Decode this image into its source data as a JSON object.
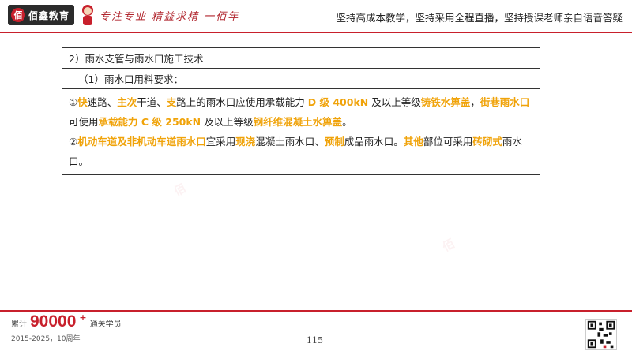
{
  "header": {
    "logo_mark": "佰",
    "logo_text": "佰鑫教育",
    "slogan": "专注专业  精益求精  一佰年",
    "tagline": "坚持高成本教学，坚持采用全程直播，坚持授课老师亲自语音答疑"
  },
  "content": {
    "title": "2）雨水支管与雨水口施工技术",
    "subtitle": "（1）雨水口用料要求：",
    "p1": [
      {
        "t": "①",
        "h": false
      },
      {
        "t": "快",
        "h": true
      },
      {
        "t": "速路、",
        "h": false
      },
      {
        "t": "主次",
        "h": true
      },
      {
        "t": "干道、",
        "h": false
      },
      {
        "t": "支",
        "h": true
      },
      {
        "t": "路上的雨水口应使用承载能力 ",
        "h": false
      },
      {
        "t": "D 级 400kN",
        "h": true
      },
      {
        "t": " 及以上等级",
        "h": false
      },
      {
        "t": "铸铁水箅盖",
        "h": true
      },
      {
        "t": "，",
        "h": false
      },
      {
        "t": "街巷雨水口",
        "h": true
      },
      {
        "t": "可使用",
        "h": false
      },
      {
        "t": "承载能力 C 级 250kN",
        "h": true
      },
      {
        "t": " 及以上等级",
        "h": false
      },
      {
        "t": "钢纤维混凝土水箅盖",
        "h": true
      },
      {
        "t": "。",
        "h": false
      }
    ],
    "p2": [
      {
        "t": "②",
        "h": false
      },
      {
        "t": "机动车道及非机动车道雨水口",
        "h": true
      },
      {
        "t": "宜采用",
        "h": false
      },
      {
        "t": "现浇",
        "h": true
      },
      {
        "t": "混凝土雨水口、",
        "h": false
      },
      {
        "t": "预制",
        "h": true
      },
      {
        "t": "成品雨水口。",
        "h": false
      },
      {
        "t": "其他",
        "h": true
      },
      {
        "t": "部位可采用",
        "h": false
      },
      {
        "t": "砖砌式",
        "h": true
      },
      {
        "t": "雨水口。",
        "h": false
      }
    ]
  },
  "footer": {
    "stat_prefix": "累计",
    "stat_number": "90000",
    "stat_plus": "+",
    "stat_suffix": "通关学员",
    "years": "2015-2025，10周年",
    "page_number": "115"
  },
  "colors": {
    "brand_red": "#c8202c",
    "highlight_orange": "#f0a30a"
  }
}
